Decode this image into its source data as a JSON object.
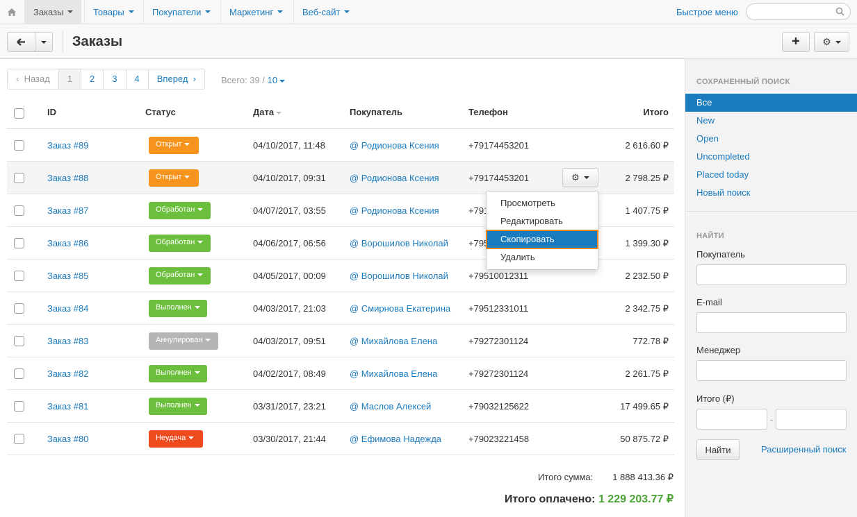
{
  "topnav": {
    "items": [
      {
        "label": "Заказы",
        "active": true
      },
      {
        "label": "Товары"
      },
      {
        "label": "Покупатели"
      },
      {
        "label": "Маркетинг"
      },
      {
        "label": "Веб-сайт"
      }
    ],
    "quick_menu": "Быстрое меню",
    "search_placeholder": ""
  },
  "header": {
    "title": "Заказы"
  },
  "pagination": {
    "prev": "Назад",
    "pages": [
      "1",
      "2",
      "3",
      "4"
    ],
    "current": "1",
    "next": "Вперед",
    "total_label": "Всего: 39 /",
    "per_page": "10"
  },
  "table": {
    "headers": {
      "id": "ID",
      "status": "Статус",
      "date": "Дата",
      "customer": "Покупатель",
      "phone": "Телефон",
      "total": "Итого"
    },
    "rows": [
      {
        "id": "Заказ #89",
        "status": "Открыт",
        "status_color": "#f7941d",
        "date": "04/10/2017, 11:48",
        "customer": "@ Родионова Ксения",
        "phone": "+79174453201",
        "total": "2 616.60 ₽"
      },
      {
        "id": "Заказ #88",
        "status": "Открыт",
        "status_color": "#f7941d",
        "date": "04/10/2017, 09:31",
        "customer": "@ Родионова Ксения",
        "phone": "+79174453201",
        "total": "2 798.25 ₽"
      },
      {
        "id": "Заказ #87",
        "status": "Обработан",
        "status_color": "#6cbf3c",
        "date": "04/07/2017, 03:55",
        "customer": "@ Родионова Ксения",
        "phone": "+791",
        "total": "1 407.75 ₽"
      },
      {
        "id": "Заказ #86",
        "status": "Обработан",
        "status_color": "#6cbf3c",
        "date": "04/06/2017, 06:56",
        "customer": "@ Ворошилов Николай",
        "phone": "+795",
        "total": "1 399.30 ₽"
      },
      {
        "id": "Заказ #85",
        "status": "Обработан",
        "status_color": "#6cbf3c",
        "date": "04/05/2017, 00:09",
        "customer": "@ Ворошилов Николай",
        "phone": "+79510012311",
        "total": "2 232.50 ₽"
      },
      {
        "id": "Заказ #84",
        "status": "Выполнен",
        "status_color": "#6cbf3c",
        "date": "04/03/2017, 21:03",
        "customer": "@ Смирнова Екатерина",
        "phone": "+79512331011",
        "total": "2 342.75 ₽"
      },
      {
        "id": "Заказ #83",
        "status": "Аннулирован",
        "status_color": "#b5b5b5",
        "date": "04/03/2017, 09:51",
        "customer": "@ Михайлова Елена",
        "phone": "+79272301124",
        "total": "772.78 ₽"
      },
      {
        "id": "Заказ #82",
        "status": "Выполнен",
        "status_color": "#6cbf3c",
        "date": "04/02/2017, 08:49",
        "customer": "@ Михайлова Елена",
        "phone": "+79272301124",
        "total": "2 261.75 ₽"
      },
      {
        "id": "Заказ #81",
        "status": "Выполнен",
        "status_color": "#6cbf3c",
        "date": "03/31/2017, 23:21",
        "customer": "@ Маслов Алексей",
        "phone": "+79032125622",
        "total": "17 499.65 ₽"
      },
      {
        "id": "Заказ #80",
        "status": "Неудача",
        "status_color": "#ee4b1f",
        "date": "03/30/2017, 21:44",
        "customer": "@ Ефимова Надежда",
        "phone": "+79023221458",
        "total": "50 875.72 ₽"
      }
    ]
  },
  "row_menu": {
    "items": [
      "Просмотреть",
      "Редактировать",
      "Скопировать",
      "Удалить"
    ],
    "highlighted": "Скопировать"
  },
  "totals": {
    "sum_label": "Итого сумма:",
    "sum_value": "1 888 413.36 ₽",
    "paid_label": "Итого оплачено:",
    "paid_value": "1 229 203.77 ₽"
  },
  "sidebar": {
    "saved_search_title": "СОХРАНЕННЫЙ ПОИСК",
    "saved_items": [
      "Все",
      "New",
      "Open",
      "Uncompleted",
      "Placed today",
      "Новый поиск"
    ],
    "active_item": "Все",
    "find_title": "НАЙТИ",
    "fields": {
      "customer": "Покупатель",
      "email": "E-mail",
      "manager": "Менеджер",
      "total": "Итого (₽)"
    },
    "range_separator": "-",
    "find_button": "Найти",
    "advanced_link": "Расширенный поиск"
  },
  "colors": {
    "accent": "#1a7bbf",
    "paid_green": "#4aa234",
    "menu_highlight_border": "#f08a24"
  },
  "icons": [
    "home-icon",
    "search-icon",
    "back-arrow-icon",
    "plus-icon",
    "gear-icon"
  ]
}
